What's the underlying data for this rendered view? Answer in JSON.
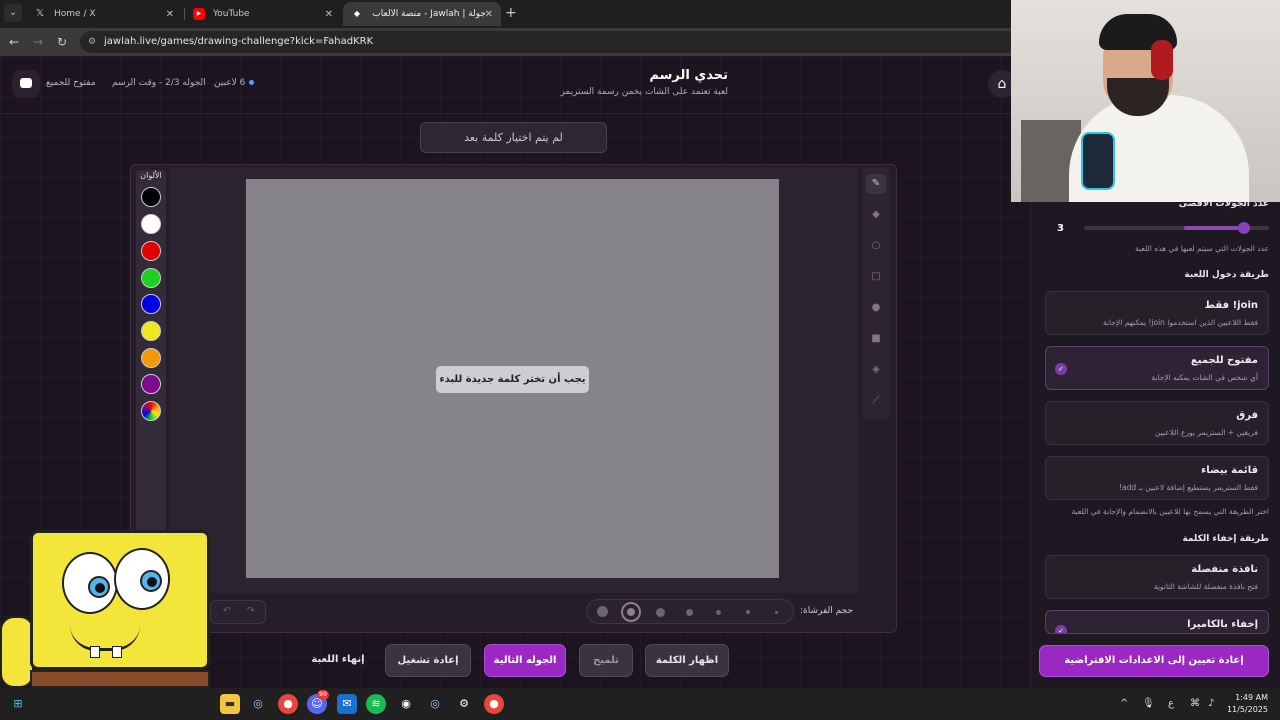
{
  "browser": {
    "tabs": [
      {
        "title": "Home / X",
        "icon": "x-logo-icon"
      },
      {
        "title": "YouTube",
        "icon": "youtube-icon"
      },
      {
        "title": "جولة | Jawlah - منصة الألعاب الا...",
        "icon": "jawlah-icon",
        "active": true
      }
    ],
    "url": "jawlah.live/games/drawing-challenge?kick=FahadKRK"
  },
  "header": {
    "title": "تحدي الرسم",
    "subtitle": "لعبة تعتمد على الشات يخمن رسمة الستريمر",
    "players": "6 لاعبين",
    "round_status": "الجوله 2/3 - وقت الرسم",
    "access": "مفتوح للجميع"
  },
  "game": {
    "word_placeholder": "لم يتم اختيار كلمة بعد",
    "canvas_message": "يجب أن تختر كلمة جديدة للبدء",
    "palette_title": "الألوان",
    "colors": [
      "#000000",
      "#ffffff",
      "#e00000",
      "#1fd11f",
      "#0000e6",
      "#f0e81e",
      "#f39a0c",
      "#7c0a8a"
    ],
    "brush_label": "حجم الفرشاة:",
    "brush_size_selected": 2
  },
  "controls": {
    "show_word": "اظهار الكلمة",
    "hint": "تلميح",
    "next_round": "الجوله التالية",
    "restart": "إعادة تشغيل",
    "end_game": "إنهاء اللعبة"
  },
  "sidebar": {
    "rounds_heading": "عدد الجولات الأقصى",
    "rounds_value": "3",
    "rounds_fraction": 0.8,
    "rounds_note": "عدد الجولات التي سيتم لعبها في هذه اللعبة",
    "join_heading": "طريقة دخول اللعبة",
    "join_options": [
      {
        "title": "join! فقط",
        "desc": "فقط اللاعبين الذين استخدموا join! يمكنهم الإجابة",
        "selected": false
      },
      {
        "title": "مفتوح للجميع",
        "desc": "أي شخص في الشات يمكنه الإجابة",
        "selected": true
      },
      {
        "title": "فرق",
        "desc": "فريقين + الستريمر يوزع اللاعبين",
        "selected": false
      },
      {
        "title": "قائمة بيضاء",
        "desc": "فقط الستريمر يستطيع إضافة لاعبين بـ add!",
        "selected": false
      }
    ],
    "join_note": "اختر الطريقة التي يسمح بها للاعبين بالانضمام والإجابة في اللعبة",
    "hide_heading": "طريقة إخفاء الكلمة",
    "hide_options": [
      {
        "title": "نافذة منفصلة",
        "desc": "فتح نافذة منفصلة للشاشة الثانوية",
        "selected": false
      },
      {
        "title": "إخفاء بالكاميرا",
        "desc": "",
        "selected": true
      }
    ],
    "reset_button": "إعادة تعيين إلى الاعدادات الافتراضية"
  },
  "taskbar": {
    "time": "1:49 AM",
    "date": "11/5/2025",
    "lang": "ع",
    "discord_badge": "99"
  }
}
